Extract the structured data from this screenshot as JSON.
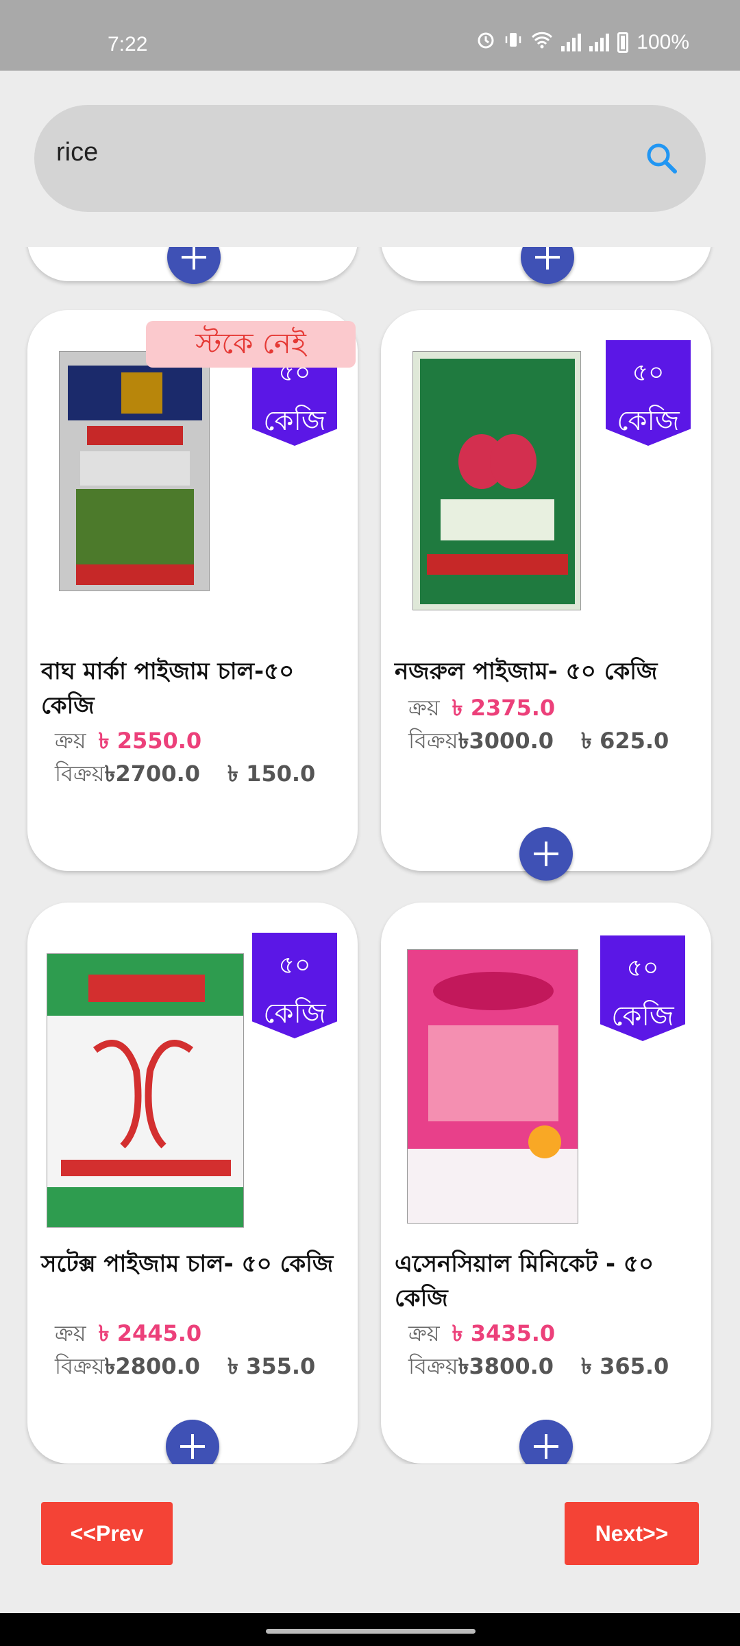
{
  "status_bar": {
    "time": "7:22",
    "battery": "100%"
  },
  "search": {
    "value": "rice"
  },
  "products": [
    {
      "name": "বাঘ মার্কা পাইজাম চাল-৫০ কেজি",
      "weight_num": "৫০",
      "weight_unit": "কেজি",
      "stock_label": "স্টকে নেই",
      "buy_label": "ক্রয়",
      "buy_price": "৳ 2550.0",
      "sell_label": "বিক্রয়",
      "sell_price": "৳2700.0",
      "profit": "৳ 150.0",
      "bag_colors": [
        "#c9c9c9",
        "#1b2a6b",
        "#b8860b",
        "#4c7a2b"
      ]
    },
    {
      "name": "নজরুল পাইজাম- ৫০ কেজি",
      "weight_num": "৫০",
      "weight_unit": "কেজি",
      "buy_label": "ক্রয়",
      "buy_price": "৳ 2375.0",
      "sell_label": "বিক্রয়",
      "sell_price": "৳3000.0",
      "profit": "৳ 625.0",
      "bag_colors": [
        "#dfe8d8",
        "#1f7a3f",
        "#d32f4f",
        "#e8f0e0"
      ]
    },
    {
      "name": "সটেক্স  পাইজাম চাল- ৫০ কেজি",
      "weight_num": "৫০",
      "weight_unit": "কেজি",
      "buy_label": "ক্রয়",
      "buy_price": "৳ 2445.0",
      "sell_label": "বিক্রয়",
      "sell_price": "৳2800.0",
      "profit": "৳ 355.0",
      "bag_colors": [
        "#f4f4f4",
        "#2e9c4f",
        "#d32f2f",
        "#f4f4f4"
      ]
    },
    {
      "name": "এসেনসিয়াল মিনিকেট - ৫০ কেজি",
      "weight_num": "৫০",
      "weight_unit": "কেজি",
      "buy_label": "ক্রয়",
      "buy_price": "৳ 3435.0",
      "sell_label": "বিক্রয়",
      "sell_price": "৳3800.0",
      "profit": "৳ 365.0",
      "bag_colors": [
        "#e8408a",
        "#c2185b",
        "#f48fb1",
        "#f7f1f4"
      ]
    }
  ],
  "pagination": {
    "prev_label": "<<Prev",
    "next_label": "Next>>"
  },
  "colors": {
    "accent": "#3f51b5",
    "badge": "#5b17e6",
    "price": "#ec407a",
    "nav_button": "#f44336"
  }
}
